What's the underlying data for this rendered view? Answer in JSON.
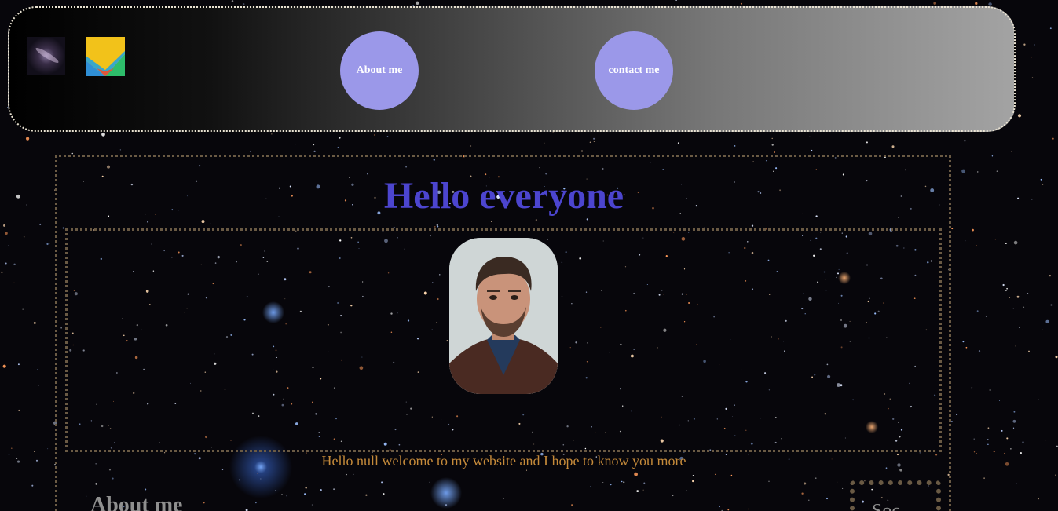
{
  "header": {
    "logo_galaxy_icon": "galaxy-icon",
    "logo_app_icon": "app-logo-icon",
    "nav": {
      "about_label": "About me",
      "contact_label": "contact me"
    },
    "accent_color": "#9b98e9"
  },
  "main": {
    "title": "Hello everyone",
    "title_color": "#4c45cf",
    "avatar_icon": "profile-photo",
    "welcome_text": "Hello null welcome to my website and I hope to know you more",
    "welcome_color": "#c58a3a",
    "about_heading": "About me",
    "side_text": "Soc"
  }
}
